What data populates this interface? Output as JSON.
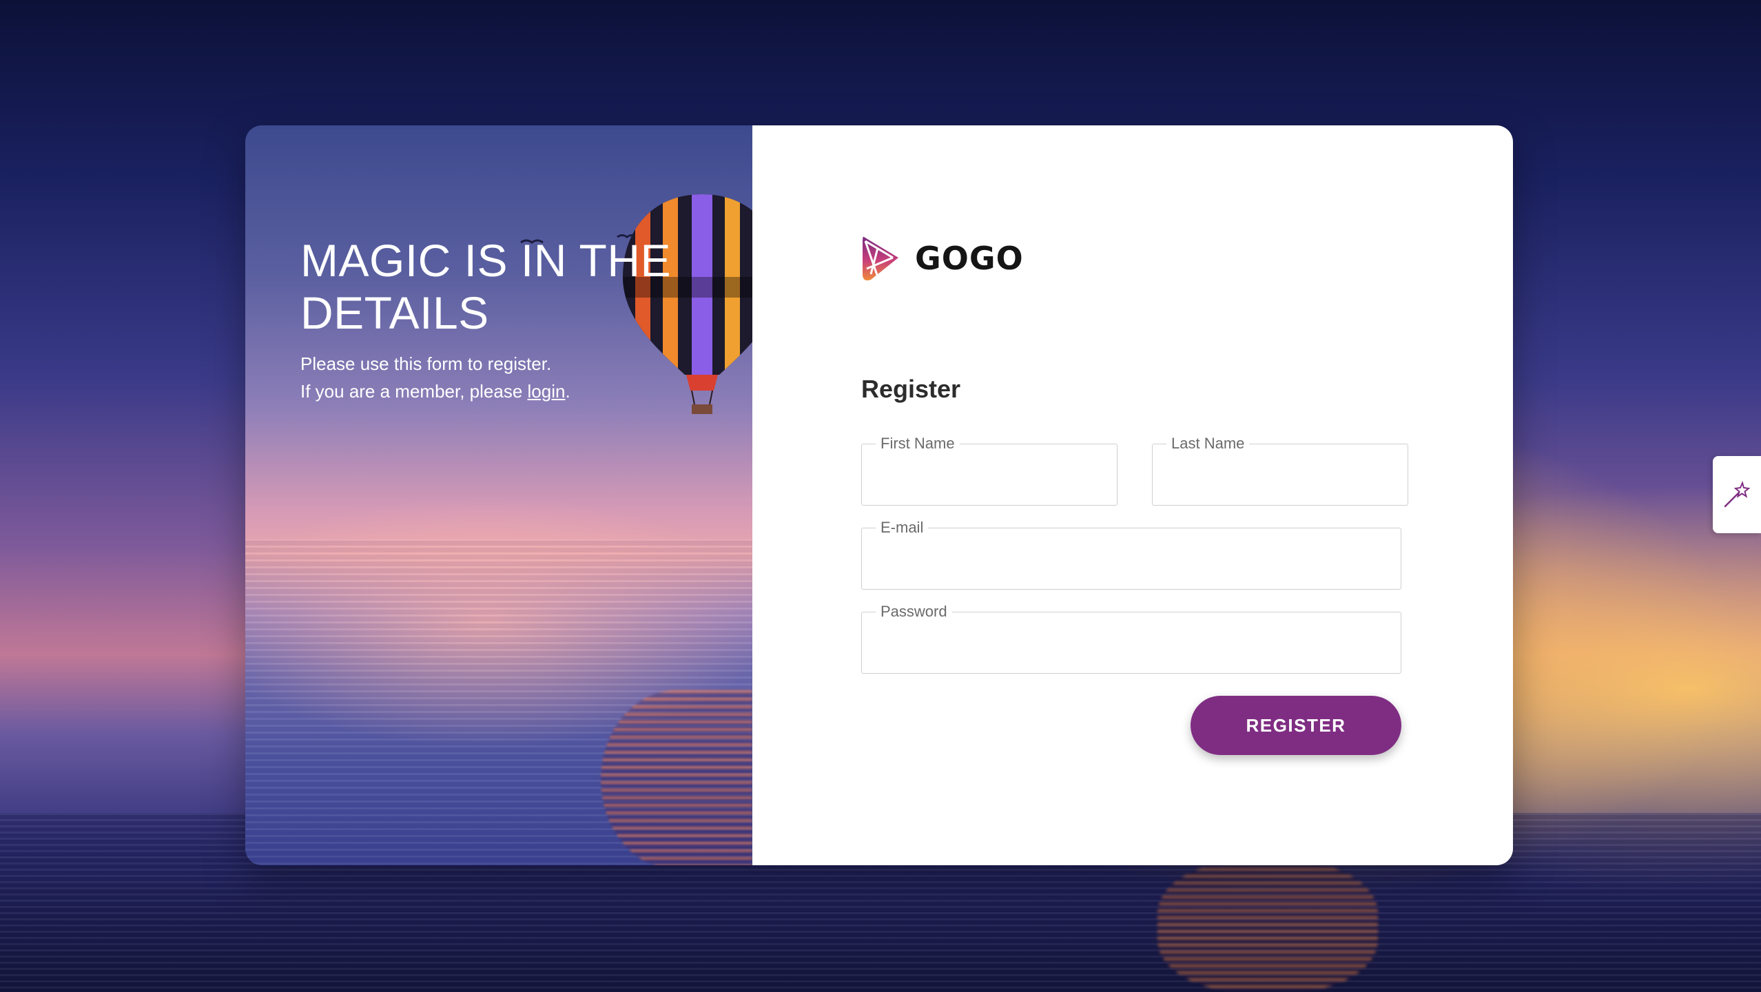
{
  "hero": {
    "headline": "MAGIC IS IN THE DETAILS",
    "line1": "Please use this form to register.",
    "line2_prefix": "If you are a member, please ",
    "login_link": "login",
    "line2_suffix": "."
  },
  "brand": {
    "name": "GOGO",
    "logo_icon": "gogo-logo-icon"
  },
  "form": {
    "title": "Register",
    "first_name_label": "First Name",
    "first_name_value": "",
    "last_name_label": "Last Name",
    "last_name_value": "",
    "email_label": "E-mail",
    "email_value": "",
    "password_label": "Password",
    "password_value": "",
    "submit_label": "REGISTER"
  },
  "side_tab": {
    "icon": "magic-wand-icon"
  },
  "colors": {
    "accent": "#7f2d83",
    "card_background": "#ffffff",
    "field_border": "#cfcfcf"
  }
}
